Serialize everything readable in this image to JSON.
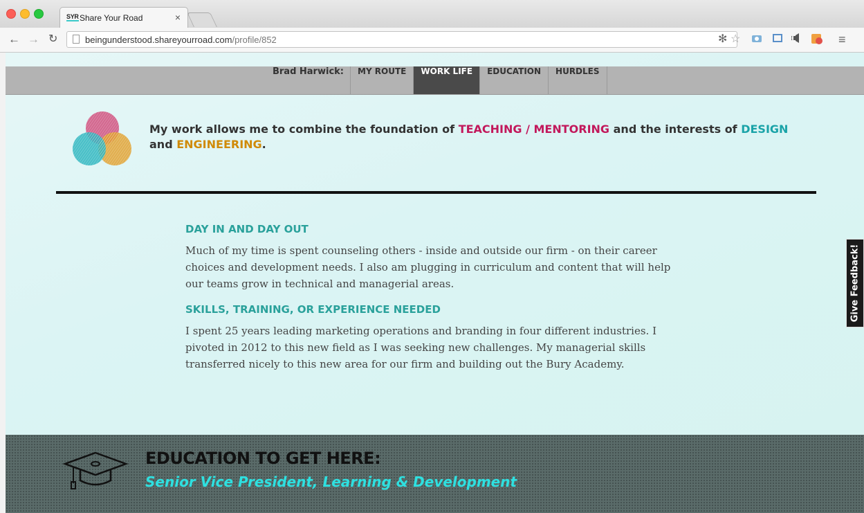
{
  "browser": {
    "tab_favicon": "SYR",
    "tab_title": "Share Your Road",
    "tab_close": "×",
    "url_domain": "beingunderstood.shareyourroad.com",
    "url_path": "/profile/852",
    "icons": [
      "back-arrow-icon",
      "forward-arrow-icon",
      "reload-icon",
      "page-icon",
      "extension-icon",
      "star-icon",
      "camera-icon",
      "screen-capture-icon",
      "audio-icon",
      "addon-icon",
      "menu-icon"
    ]
  },
  "nav": {
    "name": "Brad Harwick:",
    "items": [
      {
        "label": "MY ROUTE"
      },
      {
        "label": "WORK LIFE"
      },
      {
        "label": "EDUCATION"
      },
      {
        "label": "HURDLES"
      }
    ],
    "active_index": 1
  },
  "intro": {
    "p1": "My work allows me to combine the foundation of ",
    "h1": "TEACHING / MENTORING",
    "p2": " and the interests of ",
    "h2": "DESIGN",
    "p3": " and ",
    "h3": "ENGINEERING",
    "p4": "."
  },
  "sections": [
    {
      "heading": "DAY IN AND DAY OUT",
      "body": "Much of my time is spent counseling others - inside and outside our firm - on their career choices and development needs. I also am plugging in curriculum and content that will help our teams grow in technical and managerial areas."
    },
    {
      "heading": "SKILLS, TRAINING, OR EXPERIENCE NEEDED",
      "body": "I spent 25 years leading marketing operations and branding in four different industries. I pivoted in 2012 to this new field as I was seeking new challenges. My managerial skills transferred nicely to this new area for our firm and building out the Bury Academy."
    }
  ],
  "feedback": {
    "label": "Give Feedback!"
  },
  "education": {
    "title": "EDUCATION TO GET HERE:",
    "subtitle": "Senior Vice President, Learning & Development"
  },
  "colors": {
    "pink": "#c2185b",
    "teal": "#1aa3a8",
    "gold": "#d08a07",
    "section_heading": "#2aa19b",
    "edu_subtitle": "#2ee0e0"
  }
}
